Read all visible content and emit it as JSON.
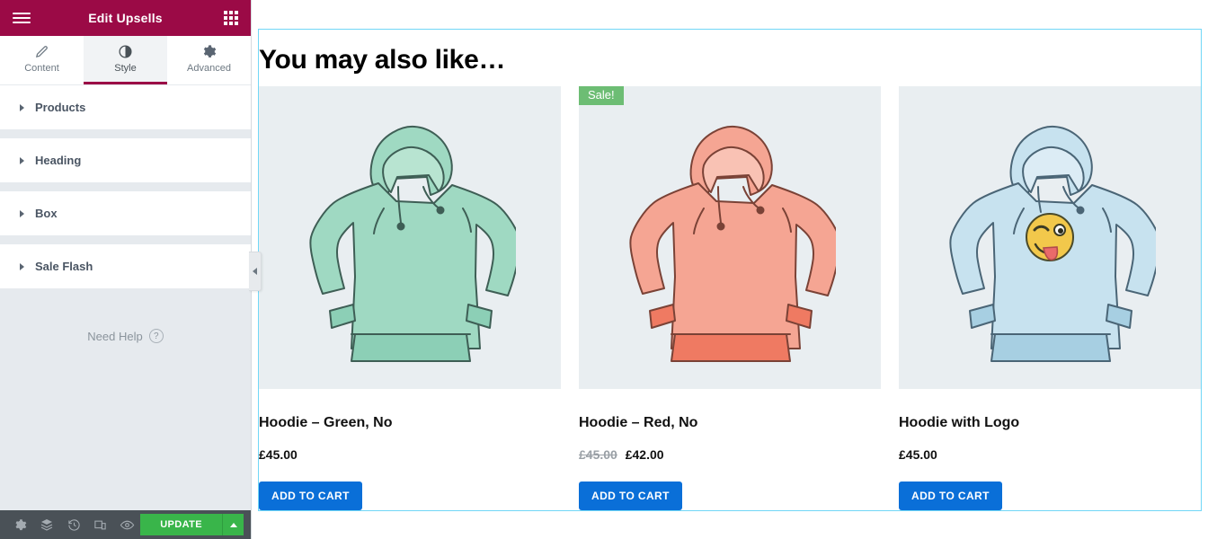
{
  "panel": {
    "title": "Edit Upsells",
    "menu_icon": "hamburger-icon",
    "apps_icon": "grid-icon",
    "tabs": [
      {
        "label": "Content",
        "icon": "pencil-icon",
        "active": false
      },
      {
        "label": "Style",
        "icon": "contrast-icon",
        "active": true
      },
      {
        "label": "Advanced",
        "icon": "gear-icon",
        "active": false
      }
    ],
    "sections": [
      {
        "label": "Products"
      },
      {
        "label": "Heading"
      },
      {
        "label": "Box"
      },
      {
        "label": "Sale Flash"
      }
    ],
    "need_help": "Need Help",
    "need_help_icon": "question-circle-icon",
    "collapse_icon": "chevron-left-icon"
  },
  "bottom_bar": {
    "icons": [
      {
        "name": "settings-gear-icon"
      },
      {
        "name": "layers-navigator-icon"
      },
      {
        "name": "history-clock-icon"
      },
      {
        "name": "responsive-mode-icon"
      },
      {
        "name": "preview-eye-icon"
      }
    ],
    "update_label": "UPDATE",
    "update_caret_icon": "caret-up-icon",
    "update_color": "#39b54a"
  },
  "canvas": {
    "heading": "You may also like…",
    "accent_border": "#71d7f7",
    "products": [
      {
        "title": "Hoodie – Green, No",
        "price": "£45.00",
        "regular_price": null,
        "sale_price": null,
        "on_sale": false,
        "sale_badge": "",
        "button": "ADD TO CART",
        "image_alt": "green-hoodie-illustration",
        "color": "#9fd9c2",
        "color_dark": "#6cbfa4",
        "has_logo": false
      },
      {
        "title": "Hoodie – Red, No",
        "price": "£42.00",
        "regular_price": "£45.00",
        "sale_price": "£42.00",
        "on_sale": true,
        "sale_badge": "Sale!",
        "button": "ADD TO CART",
        "image_alt": "red-hoodie-illustration",
        "color": "#f5a593",
        "color_dark": "#ef7a62",
        "has_logo": false
      },
      {
        "title": "Hoodie with Logo",
        "price": "£45.00",
        "regular_price": null,
        "sale_price": null,
        "on_sale": false,
        "sale_badge": "",
        "button": "ADD TO CART",
        "image_alt": "blue-hoodie-with-logo-illustration",
        "color": "#c7e2ef",
        "color_dark": "#a7cfe2",
        "has_logo": true,
        "logo_icon": "winking-tongue-emoji"
      }
    ]
  }
}
